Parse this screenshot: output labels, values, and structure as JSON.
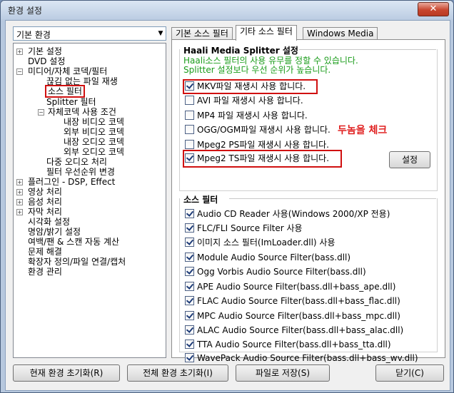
{
  "window": {
    "title": "환경 설정",
    "close_glyph": "✕"
  },
  "combo": {
    "value": "기본 환경",
    "arrow": "▼"
  },
  "tree": {
    "items": [
      {
        "label": "기본 설정",
        "expander": "+"
      },
      {
        "label": "DVD 설정",
        "expander": ""
      },
      {
        "label": "미디어/자체 코덱/필터",
        "expander": "−"
      },
      {
        "label": "끊김 없는 파일 재생",
        "expander": ""
      },
      {
        "label": "소스 필터",
        "expander": ""
      },
      {
        "label": "Splitter 필터",
        "expander": ""
      },
      {
        "label": "자체코덱 사용 조건",
        "expander": "−"
      },
      {
        "label": "내장 비디오 코덱",
        "expander": ""
      },
      {
        "label": "외부 비디오 코덱",
        "expander": ""
      },
      {
        "label": "내장 오디오 코덱",
        "expander": ""
      },
      {
        "label": "외부 오디오 코덱",
        "expander": ""
      },
      {
        "label": "다중 오디오 처리",
        "expander": ""
      },
      {
        "label": "필터 우선순위 변경",
        "expander": ""
      },
      {
        "label": "플러그인 - DSP, Effect",
        "expander": "+"
      },
      {
        "label": "영상 처리",
        "expander": "+"
      },
      {
        "label": "음성 처리",
        "expander": "+"
      },
      {
        "label": "자막 처리",
        "expander": "+"
      },
      {
        "label": "시각화 설정",
        "expander": ""
      },
      {
        "label": "명암/밝기 설정",
        "expander": ""
      },
      {
        "label": "여백/팬 & 스캔 자동 계산",
        "expander": ""
      },
      {
        "label": "문제 해결",
        "expander": ""
      },
      {
        "label": "확장자 정의/파일 연결/캡처",
        "expander": ""
      },
      {
        "label": "환경 관리",
        "expander": ""
      }
    ]
  },
  "tabs": [
    {
      "label": "기본 소스 필터",
      "active": false
    },
    {
      "label": "기타 소스 필터",
      "active": true
    },
    {
      "label": "Windows Media",
      "active": false
    }
  ],
  "haali": {
    "title": "Haali Media Splitter 설정",
    "info_line1": "Haali소스 필터의 사용 유무를 정할 수 있습니다.",
    "info_line2": "Splitter 설정보다 우선 순위가 높습니다.",
    "options": [
      {
        "label": "MKV파일 재생시 사용 합니다.",
        "checked": true
      },
      {
        "label": "AVI 파일 재생시 사용 합니다.",
        "checked": false
      },
      {
        "label": "MP4 파일 재생시 사용 합니다.",
        "checked": false
      },
      {
        "label": "OGG/OGM파일 재생시 사용 합니다.",
        "checked": false
      },
      {
        "label": "Mpeg2 PS파일 재생시 사용 합니다.",
        "checked": false
      },
      {
        "label": "Mpeg2 TS파일 재생시 사용 합니다.",
        "checked": true
      }
    ],
    "settings_button": "설정",
    "annotation": "두놈을 체크",
    "annotation_color": "#e02020"
  },
  "source_filter": {
    "title": "소스 필터",
    "options": [
      {
        "label": "Audio CD Reader 사용(Windows 2000/XP 전용)",
        "checked": true
      },
      {
        "label": "FLC/FLI Source Filter 사용",
        "checked": true
      },
      {
        "label": "이미지 소스 필터(ImLoader.dll) 사용",
        "checked": true
      },
      {
        "label": "Module Audio Source Filter(bass.dll)",
        "checked": true
      },
      {
        "label": "Ogg Vorbis Audio Source Filter(bass.dll)",
        "checked": true
      },
      {
        "label": "APE Audio Source Filter(bass.dll+bass_ape.dll)",
        "checked": true
      },
      {
        "label": "FLAC Audio Source Filter(bass.dll+bass_flac.dll)",
        "checked": true
      },
      {
        "label": "MPC Audio Source Filter(bass.dll+bass_mpc.dll)",
        "checked": true
      },
      {
        "label": "ALAC Audio Source Filter(bass.dll+bass_alac.dll)",
        "checked": true
      },
      {
        "label": "TTA Audio Source Filter(bass.dll+bass_tta.dll)",
        "checked": true
      },
      {
        "label": "WavePack Audio Source Filter(bass.dll+bass_wv.dll)",
        "checked": true
      }
    ]
  },
  "buttons": {
    "reset_current": "현재 환경 초기화(R)",
    "reset_all": "전체 환경 초기화(I)",
    "save_file": "파일로 저장(S)",
    "close": "닫기(C)"
  }
}
